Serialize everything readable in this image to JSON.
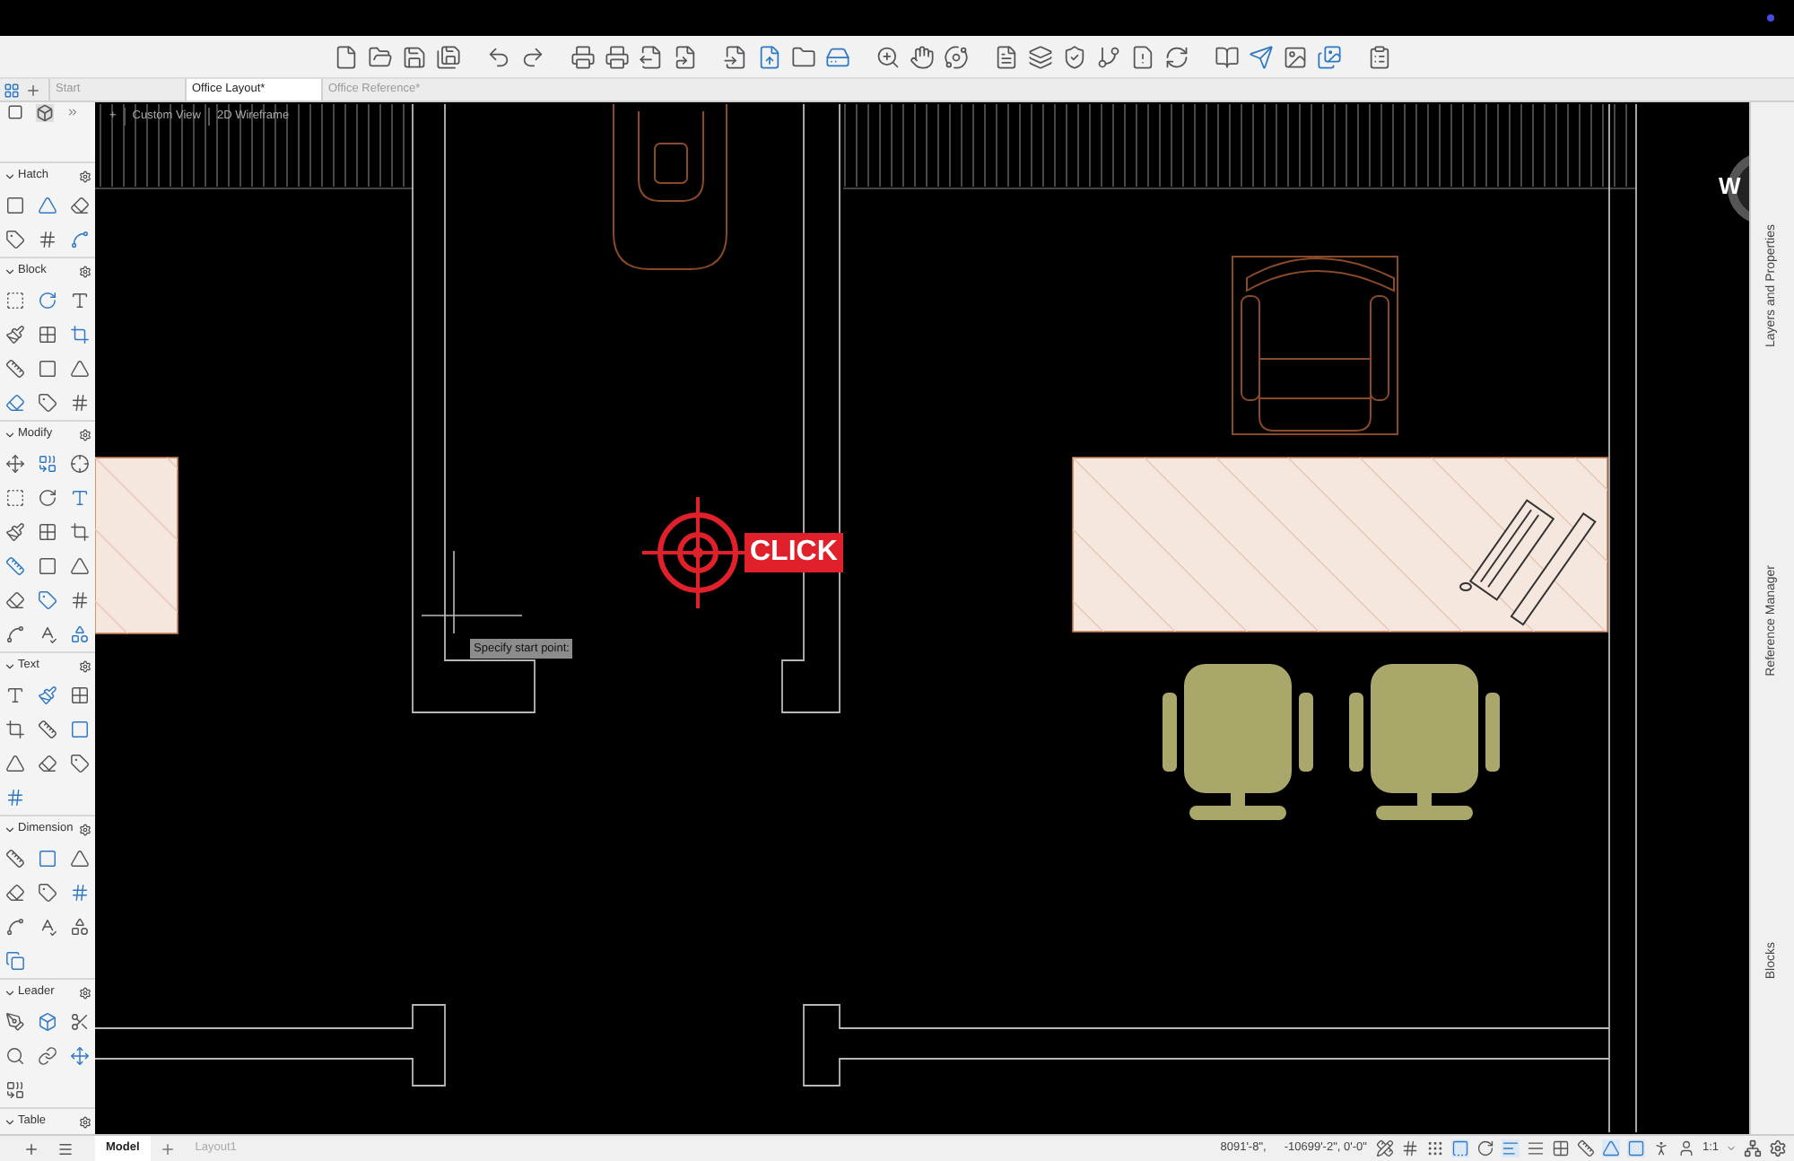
{
  "tabs": [
    {
      "label": "Start",
      "selected": false
    },
    {
      "label": "Office Layout*",
      "selected": true
    },
    {
      "label": "Office Reference*",
      "selected": false
    }
  ],
  "viewport": {
    "control": "+",
    "view": "Custom View",
    "visual_style": "2D Wireframe"
  },
  "palette": [
    {
      "title": "Hatch",
      "expanded": true
    },
    {
      "title": "Block",
      "expanded": true
    },
    {
      "title": "Modify",
      "expanded": true
    },
    {
      "title": "Text",
      "expanded": true
    },
    {
      "title": "Dimension",
      "expanded": true
    },
    {
      "title": "Leader",
      "expanded": true
    },
    {
      "title": "Table",
      "expanded": true
    }
  ],
  "canvas": {
    "prompt": "Specify start point:",
    "callout": "CLICK",
    "compass": "W"
  },
  "side_panels": [
    "Layers and Properties",
    "Reference Manager",
    "Blocks"
  ],
  "layout_tabs": [
    {
      "label": "Model",
      "selected": true
    },
    {
      "label": "Layout1",
      "selected": false
    }
  ],
  "status_bar": {
    "coordinates": [
      "8091'-8\",",
      "-10699'-2\", 0'-0\""
    ],
    "scale": "1:1"
  }
}
